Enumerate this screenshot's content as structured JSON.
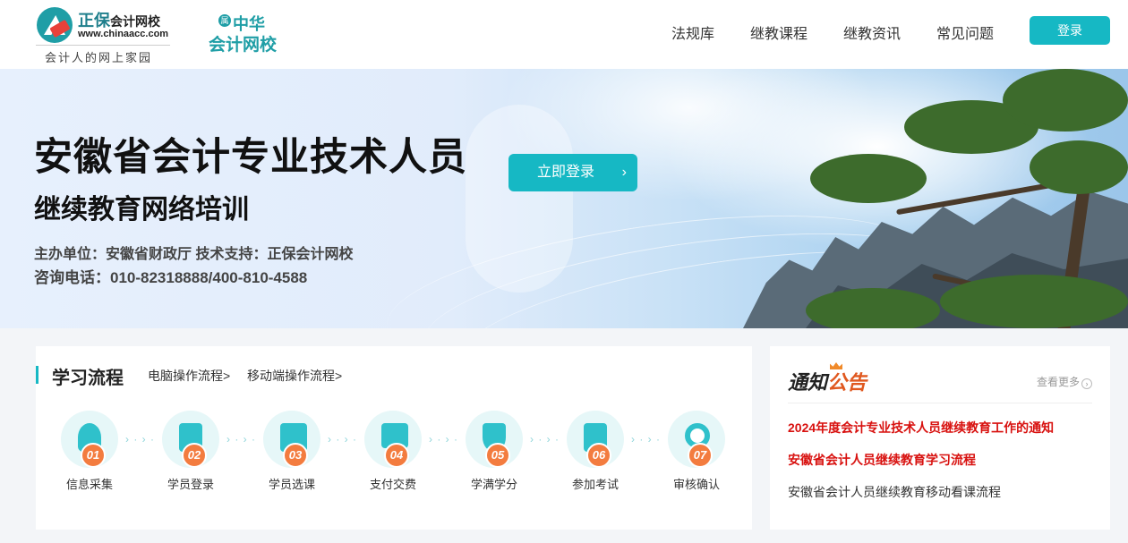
{
  "header": {
    "brand_name": "正保",
    "brand_suffix": "会计网校",
    "brand_url": "www.chinaacc.com",
    "slogan": "会计人的网上家园",
    "partner_mark": "属",
    "partner_line1": "中华",
    "partner_line2": "会计网校",
    "nav": [
      "法规库",
      "继教课程",
      "继教资讯",
      "常见问题"
    ],
    "login_label": "登录"
  },
  "banner": {
    "title": "安徽省会计专业技术人员",
    "subtitle": "继续教育网络培训",
    "organizer": "主办单位：安徽省财政厅   技术支持：正保会计网校",
    "phone": "咨询电话：010-82318888/400-810-4588",
    "cta_label": "立即登录",
    "cta_arrow": "›"
  },
  "process": {
    "title": "学习流程",
    "links": [
      "电脑操作流程>",
      "移动端操作流程>"
    ],
    "steps": [
      {
        "num": "01",
        "label": "信息采集",
        "icon": "user-icon"
      },
      {
        "num": "02",
        "label": "学员登录",
        "icon": "scroll-icon"
      },
      {
        "num": "03",
        "label": "学员选课",
        "icon": "calendar-icon"
      },
      {
        "num": "04",
        "label": "支付交费",
        "icon": "edit-icon"
      },
      {
        "num": "05",
        "label": "学满学分",
        "icon": "shield-check-icon"
      },
      {
        "num": "06",
        "label": "参加考试",
        "icon": "certificate-icon"
      },
      {
        "num": "07",
        "label": "审核确认",
        "icon": "ring-icon"
      }
    ],
    "separator": "› · › ·"
  },
  "notice": {
    "title_a": "通知",
    "title_b": "公告",
    "more_label": "查看更多",
    "more_icon": "›",
    "items": [
      "2024年度会计专业技术人员继续教育工作的通知",
      "安徽省会计人员继续教育学习流程",
      "安徽省会计人员继续教育移动看课流程"
    ]
  },
  "colors": {
    "accent": "#16b8c4",
    "step_number": "#f37c3f",
    "notice_highlight": "#d8110f"
  }
}
